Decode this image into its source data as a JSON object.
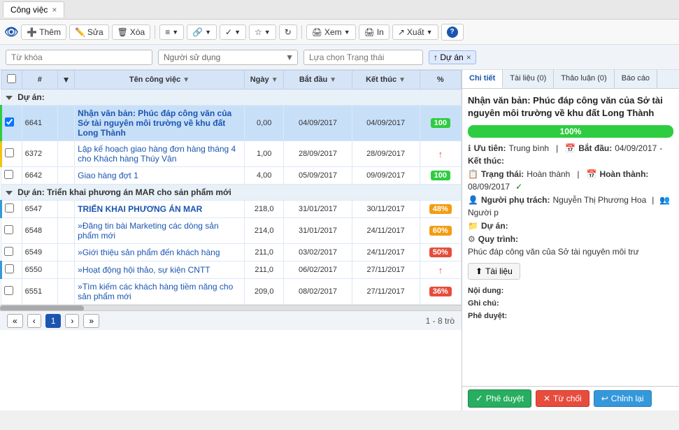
{
  "tab": {
    "label": "Công việc",
    "close": "×"
  },
  "toolbar": {
    "logo": "👁",
    "them": "Thêm",
    "sua": "Sửa",
    "xoa": "Xóa",
    "menu": "≡",
    "link": "🔗",
    "check": "✓",
    "star": "★",
    "refresh": "↻",
    "xem": "Xem",
    "in": "In",
    "xuat": "Xuất",
    "help": "?"
  },
  "filter": {
    "keyword_placeholder": "Từ khóa",
    "user_placeholder": "Người sử dụng",
    "status_placeholder": "Lựa chọn Trạng thái",
    "tag": "↑ Dự án",
    "tag_close": "×"
  },
  "table": {
    "headers": [
      "",
      "#",
      "",
      "Tên công việc",
      "Ngày",
      "Bắt đầu",
      "Kết thúc",
      "%"
    ],
    "group1_label": "Dự án:",
    "group1_expand": "▼",
    "group2_label": "Dự án: Triển khai phương án MAR cho sản phẩm mới",
    "group2_expand": "▼",
    "rows": [
      {
        "id": "6641",
        "name": "Nhận văn bản: Phúc đáp công văn của Sở tài nguyên môi trường về khu đất Long Thành",
        "bold": true,
        "ngay": "0,00",
        "bd": "04/09/2017",
        "kt": "04/09/2017",
        "pct": "100",
        "pct_type": "green",
        "selected": true,
        "border": "green"
      },
      {
        "id": "6372",
        "name": "Lập kế hoạch giao hàng đơn hàng tháng 4 cho Khách hàng Thúy Vân",
        "bold": false,
        "ngay": "1,00",
        "bd": "28/09/2017",
        "kt": "28/09/2017",
        "pct": "↑",
        "pct_type": "arrow",
        "selected": false,
        "border": "yellow"
      },
      {
        "id": "6642",
        "name": "Giao hàng đợt 1",
        "bold": false,
        "ngay": "4,00",
        "bd": "05/09/2017",
        "kt": "09/09/2017",
        "pct": "100",
        "pct_type": "green",
        "selected": false,
        "border": ""
      },
      {
        "id": "6547",
        "name": "TRIỂN KHAI PHƯƠNG ÁN MAR",
        "bold": true,
        "ngay": "218,0",
        "bd": "31/01/2017",
        "kt": "30/11/2017",
        "pct": "48%",
        "pct_type": "orange",
        "selected": false,
        "border": "blue",
        "group": 2
      },
      {
        "id": "6548",
        "name": "»Đăng tin bài Marketing các dòng sản phẩm mới",
        "bold": false,
        "ngay": "214,0",
        "bd": "31/01/2017",
        "kt": "24/11/2017",
        "pct": "60%",
        "pct_type": "orange60",
        "selected": false,
        "border": "",
        "group": 2
      },
      {
        "id": "6549",
        "name": "»Giới thiệu sản phẩm đến khách hàng",
        "bold": false,
        "ngay": "211,0",
        "bd": "03/02/2017",
        "kt": "24/11/2017",
        "pct": "50%",
        "pct_type": "red50",
        "selected": false,
        "border": "",
        "group": 2
      },
      {
        "id": "6550",
        "name": "»Hoạt động hội thảo, sự kiện CNTT",
        "bold": false,
        "ngay": "211,0",
        "bd": "06/02/2017",
        "kt": "27/11/2017",
        "pct": "↑",
        "pct_type": "arrow",
        "selected": false,
        "border": "blue2",
        "group": 2
      },
      {
        "id": "6551",
        "name": "»Tìm kiếm các khách hàng tiềm năng cho sản phẩm mới",
        "bold": false,
        "ngay": "209,0",
        "bd": "08/02/2017",
        "kt": "27/11/2017",
        "pct": "36%",
        "pct_type": "red36",
        "selected": false,
        "border": "",
        "group": 2
      }
    ]
  },
  "right_panel": {
    "tabs": [
      {
        "label": "Chi tiết",
        "active": true
      },
      {
        "label": "Tài liệu (0)",
        "active": false
      },
      {
        "label": "Thảo luận (0)",
        "active": false
      },
      {
        "label": "Báo cáo",
        "active": false
      }
    ],
    "title": "Nhận văn bản: Phúc đáp công văn của Sở tài nguyên môi trường về khu đất Long Thành",
    "progress": "100%",
    "progress_val": 100,
    "priority_label": "Ưu tiên:",
    "priority_val": "Trung bình",
    "start_label": "Bắt đầu:",
    "start_val": "04/09/2017",
    "end_label": "Kết thúc:",
    "end_val": "",
    "status_label": "Trạng thái:",
    "status_val": "Hoàn thành",
    "complete_label": "Hoàn thành:",
    "complete_val": "08/09/2017",
    "check_icon": "✓",
    "assignee_label": "Người phụ trách:",
    "assignee_val": "Nguyễn Thị Phương Hoa",
    "people_label": "Người p",
    "project_label": "Dự án:",
    "workflow_label": "Quy trình:",
    "workflow_val": "Phúc đáp công văn của Sở tài nguyên môi trư",
    "tai_lieu_btn": "Tài liệu",
    "noi_dung_label": "Nội dung:",
    "ghi_chu_label": "Ghi chú:",
    "phe_duyet_label": "Phê duyệt:"
  },
  "footer": {
    "prev_first": "«",
    "prev": "‹",
    "page": "1",
    "next": "›",
    "next_last": "»",
    "range": "1 - 8 trò"
  },
  "action_bar": {
    "phe_duyet": "Phê duyệt",
    "tu_choi": "Từ chối",
    "chinh_lai": "Chỉnh lại"
  }
}
